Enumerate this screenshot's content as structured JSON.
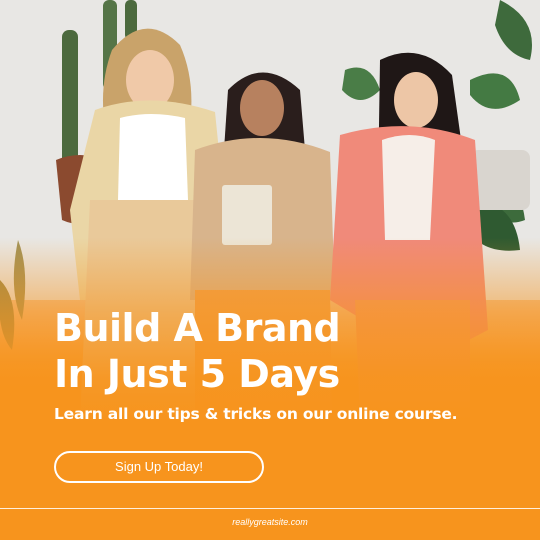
{
  "headline": {
    "line1": "Build A Brand",
    "line2": "In Just 5 Days"
  },
  "subheadline": "Learn all our tips & tricks on our online course.",
  "cta": {
    "label": "Sign Up Today!"
  },
  "footer": {
    "website": "reallygreatsite.com"
  },
  "colors": {
    "brand_orange": "#f7941d",
    "blazer_pink": "#f08a7a",
    "text": "#ffffff"
  },
  "photo": {
    "subject": "three women standing in front of plants"
  }
}
